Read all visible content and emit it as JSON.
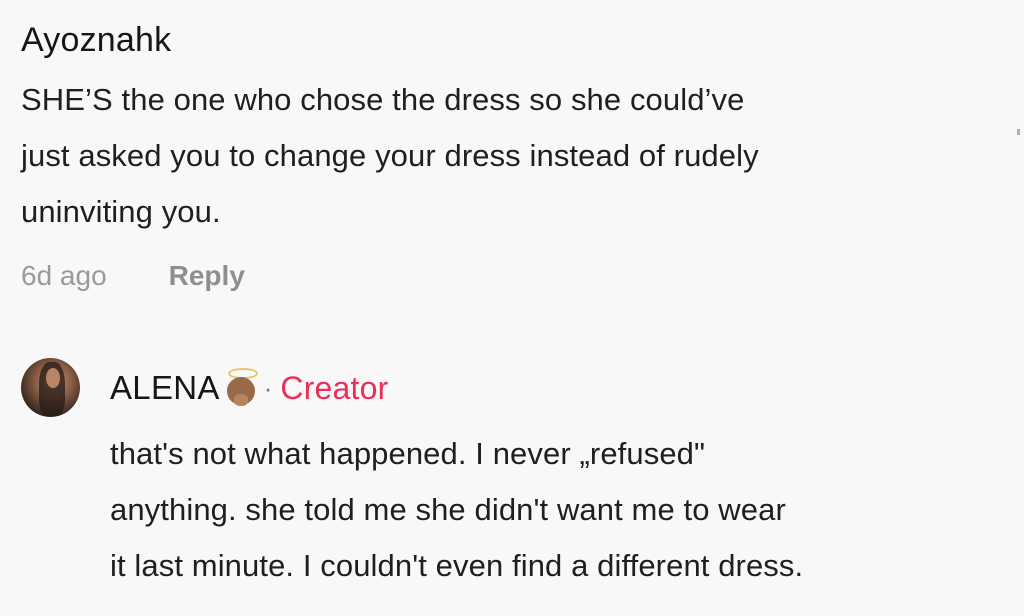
{
  "comment": {
    "username": "Ayoznahk",
    "text_lines": [
      "SHE’S the one who chose the dress so she could’ve",
      "just asked you to change your dress instead of rudely",
      "uninviting you."
    ],
    "timestamp": "6d ago",
    "reply_label": "Reply"
  },
  "reply": {
    "username": "ALENA",
    "separator": "·",
    "creator_badge": "Creator",
    "avatar_icon": "user-avatar",
    "name_emoji": "baby-angel-emoji",
    "text_lines": [
      "that's not what happened. I never „refused\"",
      "anything. she told me she didn't want me to wear",
      "it last minute. I couldn't even find a different dress."
    ]
  },
  "colors": {
    "background": "#f8f8f8",
    "text": "#1f1f1f",
    "muted": "#9a9a9a",
    "creator": "#ee2e55"
  }
}
